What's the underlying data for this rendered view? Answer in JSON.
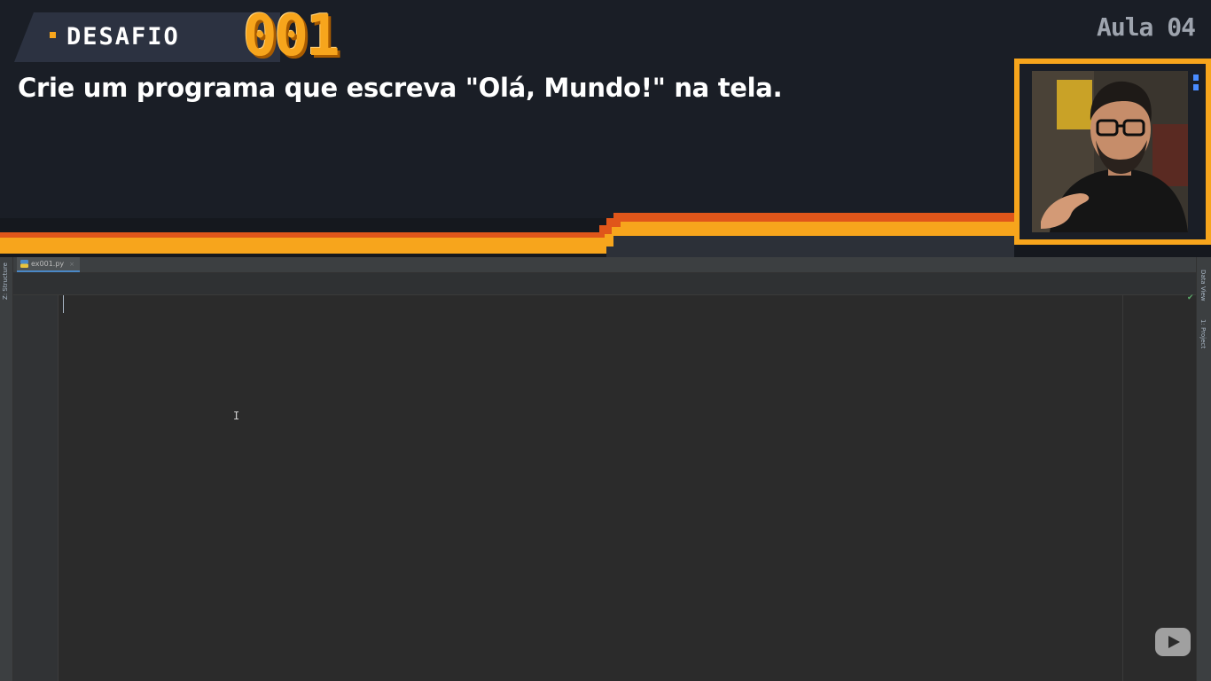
{
  "banner": {
    "label": "DESAFIO",
    "number": "001",
    "lesson": "Aula 04",
    "challenge_text": "Crie um programa que escreva \"Olá, Mundo!\" na tela."
  },
  "ide": {
    "file_tab": {
      "label": "ex001.py",
      "close": "×"
    },
    "left_toolwindow": "Z: Structure",
    "right_toolwindows": [
      "Data View",
      "1: Project"
    ],
    "code_lines": [
      ""
    ]
  },
  "colors": {
    "accent": "#f7a51c",
    "accent_dark": "#e0561a",
    "banner_bg": "#1a1e26",
    "editor_bg": "#2b2b2b",
    "tab_underline": "#4a88c7"
  },
  "icons": {
    "python_file": "python-file-icon",
    "close": "close-icon",
    "check": "check-icon",
    "youtube": "youtube-icon",
    "text_cursor": "text-cursor-icon"
  }
}
